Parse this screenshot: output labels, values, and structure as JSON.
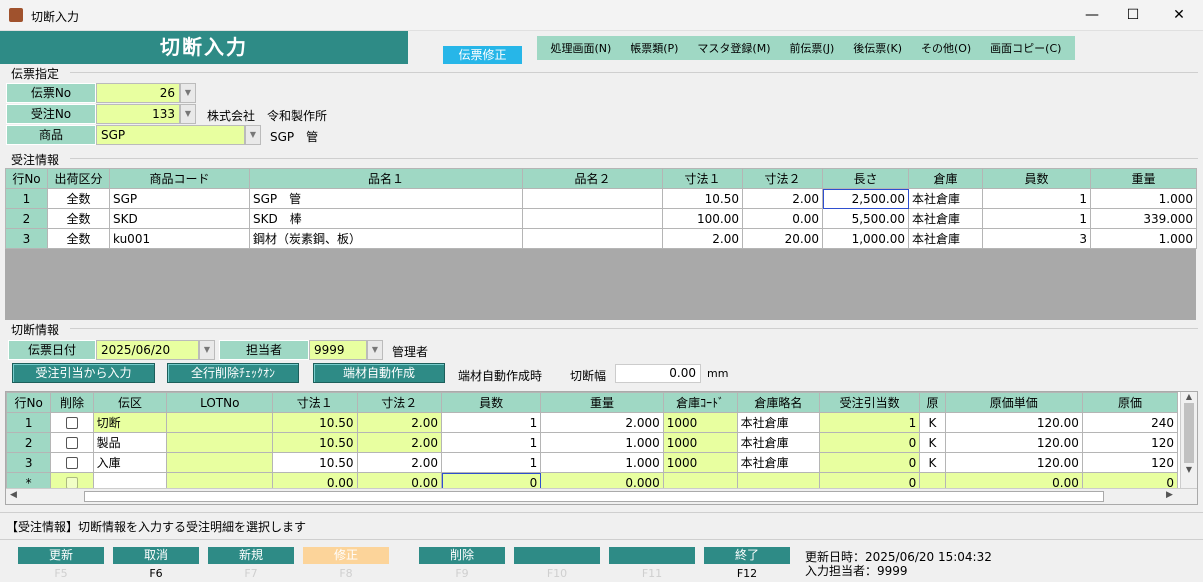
{
  "window": {
    "title": "切断入力",
    "min": "—",
    "max": "☐",
    "close": "✕"
  },
  "header": {
    "title": "切断入力",
    "mode": "伝票修正"
  },
  "menu": [
    "処理画面(N)",
    "帳票類(P)",
    "マスタ登録(M)",
    "前伝票(J)",
    "後伝票(K)",
    "その他(O)",
    "画面コピー(C)"
  ],
  "voucher": {
    "section": "伝票指定",
    "no_label": "伝票No",
    "no_value": "26",
    "order_label": "受注No",
    "order_value": "133",
    "customer": "株式会社　令和製作所",
    "product_label": "商品",
    "product_value": "SGP",
    "product_name": "SGP　管"
  },
  "order_info": {
    "section": "受注情報",
    "headers": [
      "行No",
      "出荷区分",
      "商品コード",
      "品名１",
      "品名２",
      "寸法１",
      "寸法２",
      "長さ",
      "倉庫",
      "員数",
      "重量"
    ],
    "rows": [
      [
        "1",
        "全数",
        "SGP",
        "SGP　管",
        "",
        "10.50",
        "2.00",
        "2,500.00",
        "本社倉庫",
        "1",
        "1.000"
      ],
      [
        "2",
        "全数",
        "SKD",
        "SKD　棒",
        "",
        "100.00",
        "0.00",
        "5,500.00",
        "本社倉庫",
        "1",
        "339.000"
      ],
      [
        "3",
        "全数",
        "ku001",
        "鋼材（炭素鋼、板）",
        "",
        "2.00",
        "20.00",
        "1,000.00",
        "本社倉庫",
        "3",
        "1.000"
      ]
    ]
  },
  "cut_info": {
    "section": "切断情報",
    "date_label": "伝票日付",
    "date_value": "2025/06/20",
    "staff_label": "担当者",
    "staff_value": "9999",
    "staff_name": "管理者",
    "btn_from_order": "受注引当から入力",
    "btn_delete_check": "全行削除ﾁｪｯｸｵﾝ",
    "btn_auto": "端材自動作成",
    "auto_text": "端材自動作成時",
    "width_label": "切断幅",
    "width_value": "0.00",
    "width_unit": "mm",
    "headers": [
      "行No",
      "削除",
      "伝区",
      "LOTNo",
      "寸法１",
      "寸法２",
      "員数",
      "重量",
      "倉庫ｺｰﾄﾞ",
      "倉庫略名",
      "受注引当数",
      "原",
      "原価単価",
      "原価"
    ],
    "rows": [
      [
        "1",
        "",
        "切断",
        "",
        "10.50",
        "2.00",
        "1",
        "2.000",
        "1000",
        "本社倉庫",
        "1",
        "K",
        "120.00",
        "240"
      ],
      [
        "2",
        "",
        "製品",
        "",
        "10.50",
        "2.00",
        "1",
        "1.000",
        "1000",
        "本社倉庫",
        "0",
        "K",
        "120.00",
        "120"
      ],
      [
        "3",
        "",
        "入庫",
        "",
        "10.50",
        "2.00",
        "1",
        "1.000",
        "1000",
        "本社倉庫",
        "0",
        "K",
        "120.00",
        "120"
      ],
      [
        "*",
        "",
        "",
        "",
        "0.00",
        "0.00",
        "0",
        "0.000",
        "",
        "",
        "0",
        "",
        "0.00",
        "0"
      ]
    ]
  },
  "status_message": "【受注情報】切断情報を入力する受注明細を選択します",
  "fbuttons": [
    {
      "label": "更新",
      "key": "F5"
    },
    {
      "label": "取消",
      "key": "F6"
    },
    {
      "label": "新規",
      "key": "F7"
    },
    {
      "label": "修正",
      "key": "F8"
    },
    {
      "label": "削除",
      "key": "F9"
    },
    {
      "label": "",
      "key": "F10"
    },
    {
      "label": "",
      "key": "F11"
    },
    {
      "label": "終了",
      "key": "F12"
    }
  ],
  "footer": {
    "updated": "更新日時：2025/06/20 15:04:32",
    "entered_by": "入力担当者：9999"
  }
}
